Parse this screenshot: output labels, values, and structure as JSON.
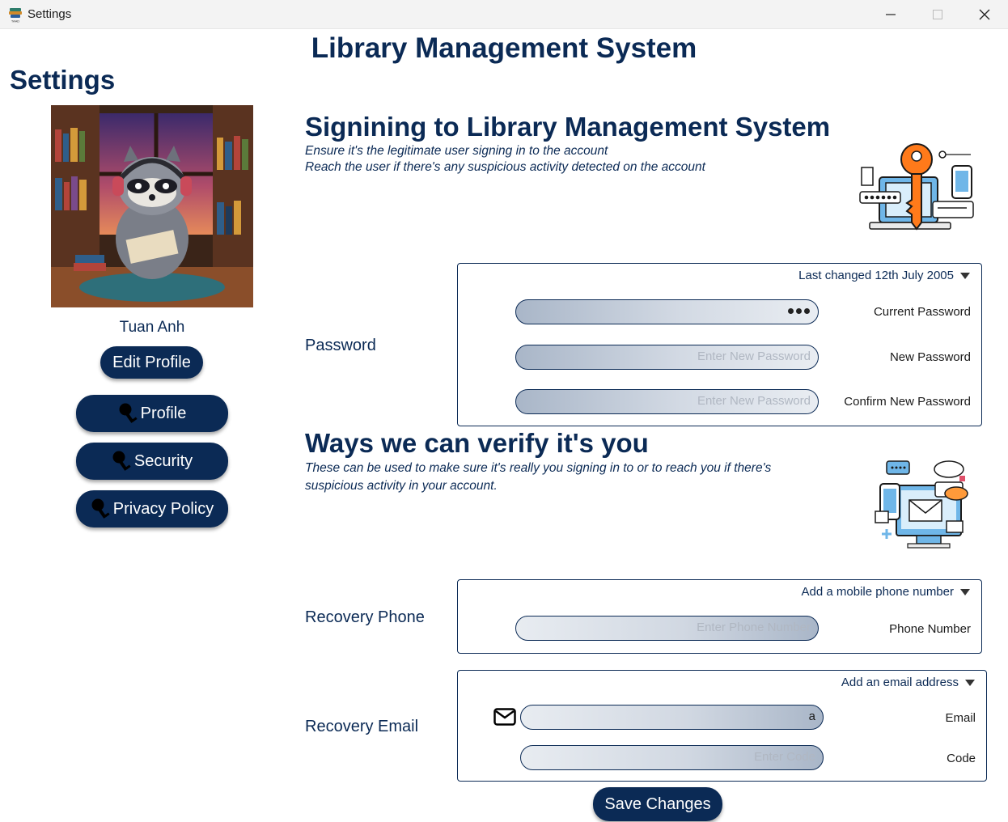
{
  "window": {
    "title": "Settings"
  },
  "app": {
    "title": "Library Management System"
  },
  "sidebar": {
    "heading": "Settings",
    "user_name": "Tuan Anh",
    "edit_profile_label": "Edit Profile",
    "nav": [
      {
        "label": "Profile",
        "icon": "key-icon"
      },
      {
        "label": "Security",
        "icon": "key-icon"
      },
      {
        "label": "Privacy Policy",
        "icon": "key-icon"
      }
    ]
  },
  "signin": {
    "title": "Signining to Library Management System",
    "desc_line1": "Ensure it's the legitimate user signing in to the account",
    "desc_line2": "Reach the user if there's any suspicious activity detected on the account",
    "illustration_icon": "key-security-icon"
  },
  "password": {
    "label": "Password",
    "last_changed": "Last changed 12th July 2005",
    "current_label": "Current Password",
    "new_label": "New Password",
    "new_placeholder": "Enter New Password",
    "confirm_label": "Confirm New Password",
    "confirm_placeholder": "Enter New Password"
  },
  "verify": {
    "title": "Ways we can verify it's you",
    "desc_line1": "These can be used to make sure it's really you signing in to or to reach you if there's",
    "desc_line2": "suspicious activity in your account.",
    "illustration_icon": "communication-icon"
  },
  "recovery_phone": {
    "label": "Recovery Phone",
    "header": "Add a mobile phone number",
    "field_label": "Phone Number",
    "placeholder": "Enter Phone Number"
  },
  "recovery_email": {
    "label": "Recovery Email",
    "header": "Add an email address",
    "email_label": "Email",
    "email_value": "a",
    "code_label": "Code",
    "code_placeholder": "Enter Code"
  },
  "save_label": "Save Changes",
  "colors": {
    "primary": "#0b2a55",
    "accent": "#ff7a1a",
    "sky": "#6fb6e8"
  }
}
